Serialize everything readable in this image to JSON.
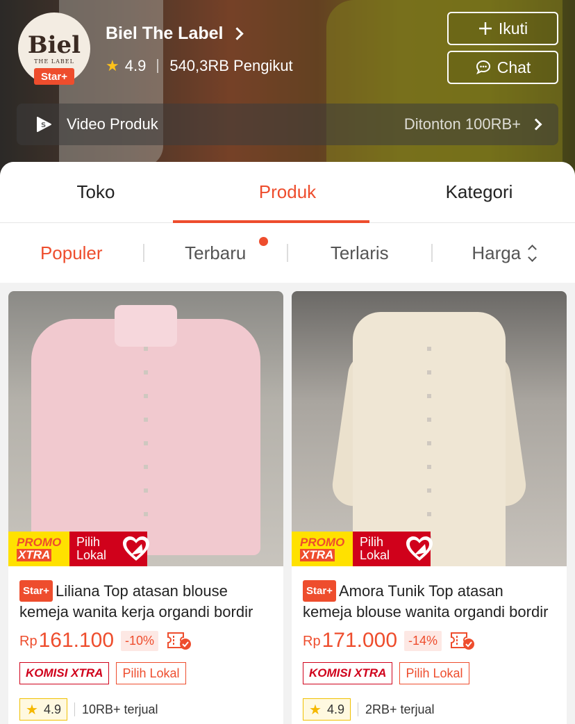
{
  "shop": {
    "logo_text": "Biel",
    "logo_subtext": "THE LABEL",
    "badge": "Star+",
    "name": "Biel The Label",
    "rating": "4.9",
    "followers": "540,3RB Pengikut",
    "follow_label": "Ikuti",
    "chat_label": "Chat"
  },
  "video": {
    "label": "Video Produk",
    "views": "Ditonton 100RB+"
  },
  "tabs": [
    {
      "label": "Toko",
      "active": false
    },
    {
      "label": "Produk",
      "active": true
    },
    {
      "label": "Kategori",
      "active": false
    }
  ],
  "sort": [
    {
      "label": "Populer",
      "active": true
    },
    {
      "label": "Terbaru",
      "active": false
    },
    {
      "label": "Terlaris",
      "active": false
    },
    {
      "label": "Harga",
      "active": false
    }
  ],
  "products": [
    {
      "badge": "Star+",
      "title": "Liliana Top atasan blouse kemeja wanita kerja organdi bordir",
      "currency": "Rp",
      "price": "161.100",
      "discount": "-10%",
      "promo_top": "PROMO",
      "promo_bottom": "XTRA",
      "promo_lokal": "Pilih Lokal",
      "tag_komisi": "KOMISI XTRA",
      "tag_lokal": "Pilih Lokal",
      "rating": "4.9",
      "sold": "10RB+ terjual"
    },
    {
      "badge": "Star+",
      "title": "Amora Tunik Top atasan kemeja blouse wanita organdi bordir",
      "currency": "Rp",
      "price": "171.000",
      "discount": "-14%",
      "promo_top": "PROMO",
      "promo_bottom": "XTRA",
      "promo_lokal": "Pilih Lokal",
      "tag_komisi": "KOMISI XTRA",
      "tag_lokal": "Pilih Lokal",
      "rating": "4.9",
      "sold": "2RB+ terjual"
    }
  ],
  "colors": {
    "accent": "#ee4d2d",
    "rating_star": "#ffc21a"
  }
}
